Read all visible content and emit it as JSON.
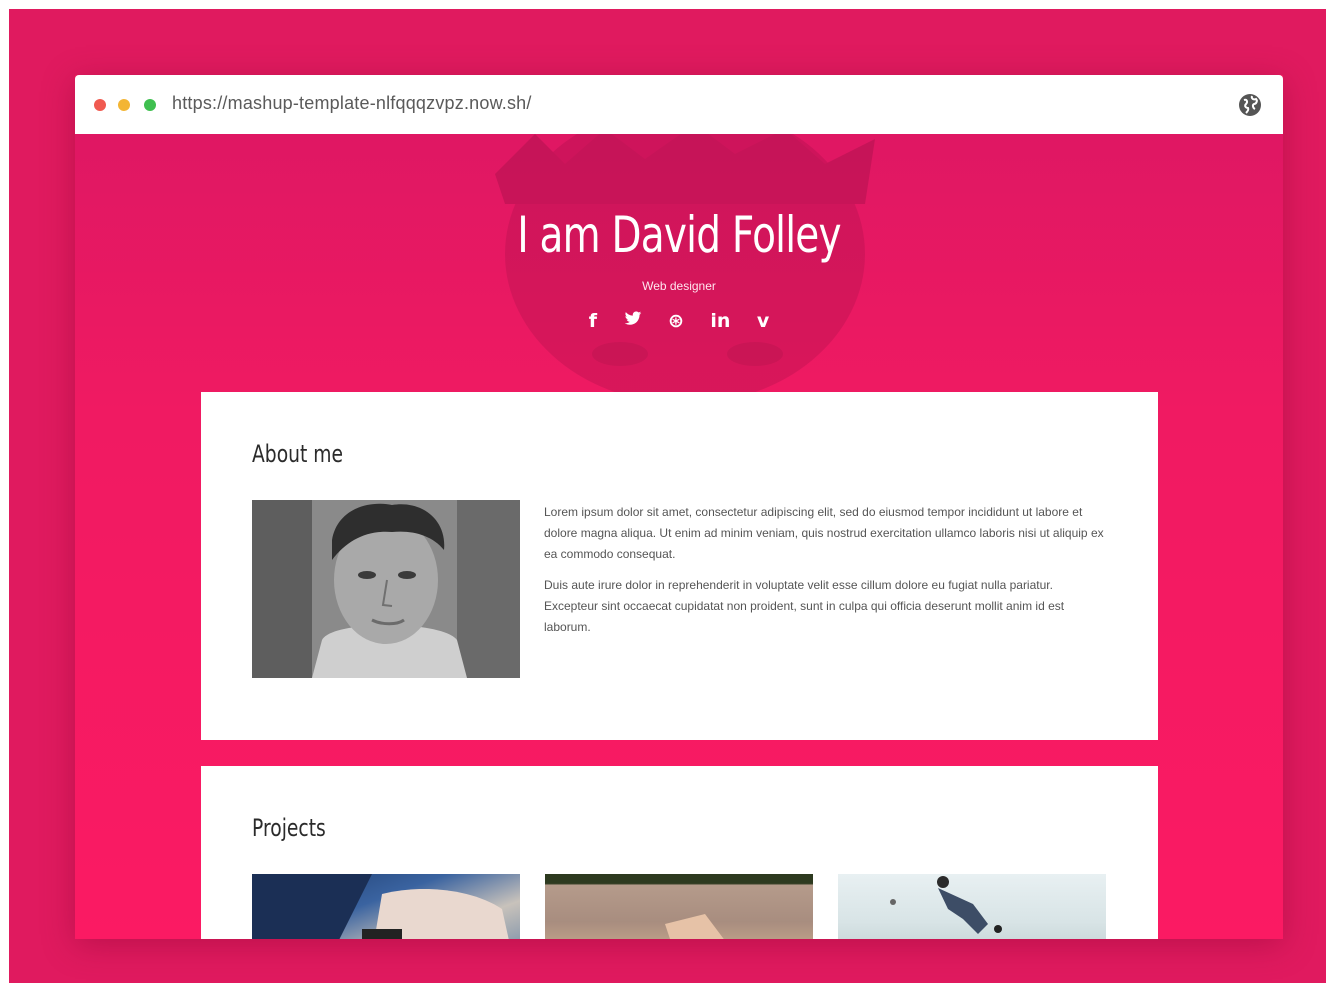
{
  "browser": {
    "url": "https://mashup-template-nlfqqqzvpz.now.sh/",
    "globe_icon": "globe-icon"
  },
  "colors": {
    "frame": "#e01a5f",
    "hero": "#f01a62",
    "card": "#ffffff"
  },
  "hero": {
    "title": "I am David Folley",
    "subtitle": "Web designer",
    "social": [
      {
        "name": "facebook-icon",
        "glyph": "f"
      },
      {
        "name": "twitter-icon",
        "glyph": "🐦"
      },
      {
        "name": "dribbble-icon",
        "glyph": "⊛"
      },
      {
        "name": "linkedin-icon",
        "glyph": "in"
      },
      {
        "name": "vimeo-icon",
        "glyph": "v"
      }
    ]
  },
  "about": {
    "title": "About me",
    "paragraphs": [
      "Lorem ipsum dolor sit amet, consectetur adipiscing elit, sed do eiusmod tempor incididunt ut labore et dolore magna aliqua. Ut enim ad minim veniam, quis nostrud exercitation ullamco laboris nisi ut aliquip ex ea commodo consequat.",
      "Duis aute irure dolor in reprehenderit in voluptate velit esse cillum dolore eu fugiat nulla pariatur. Excepteur sint occaecat cupidatat non proident, sunt in culpa qui officia deserunt mollit anim id est laborum."
    ]
  },
  "projects": {
    "title": "Projects"
  }
}
